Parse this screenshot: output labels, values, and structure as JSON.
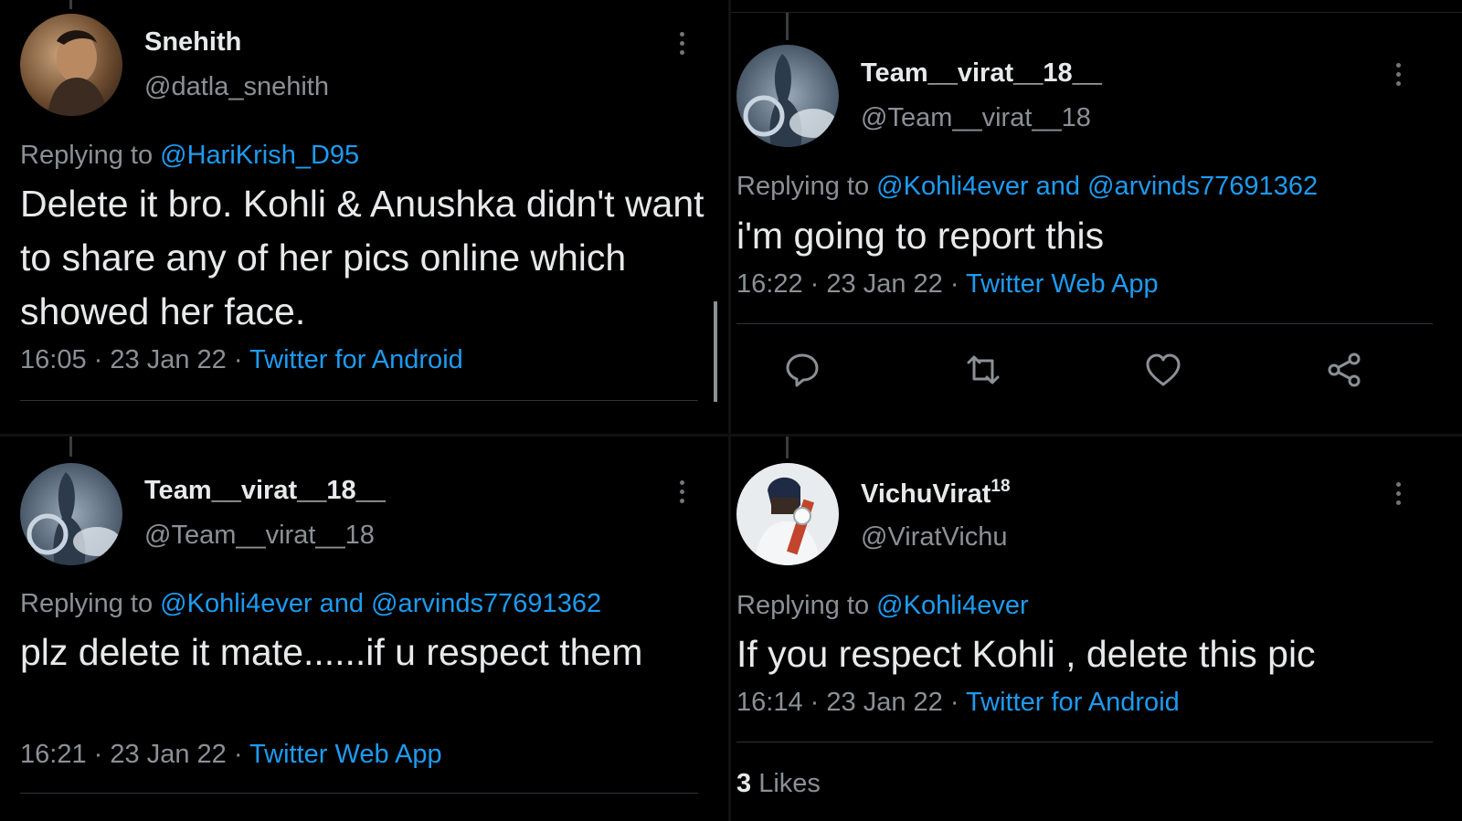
{
  "tweets": [
    {
      "name": "Snehith",
      "handle": "@datla_snehith",
      "replying_prefix": "Replying to",
      "replying_to": "@HariKrish_D95",
      "body": "Delete it bro. Kohli & Anushka didn't want to share any of her pics online which showed her face.",
      "time": "16:05",
      "date": "23 Jan 22",
      "source": "Twitter for Android"
    },
    {
      "name": "Team__virat__18__",
      "handle": "@Team__virat__18",
      "replying_prefix": "Replying to",
      "replying_to": "@Kohli4ever and @arvinds77691362",
      "body": "i'm going to report this",
      "time": "16:22",
      "date": "23 Jan 22",
      "source": "Twitter Web App"
    },
    {
      "name": "Team__virat__18__",
      "handle": "@Team__virat__18",
      "replying_prefix": "Replying to",
      "replying_to": "@Kohli4ever and @arvinds77691362",
      "body": "plz delete it mate......if u respect them",
      "time": "16:21",
      "date": "23 Jan 22",
      "source": "Twitter Web App"
    },
    {
      "name": "VichuVirat",
      "name_sup": "18",
      "handle": "@ViratVichu",
      "replying_prefix": "Replying to",
      "replying_to": "@Kohli4ever",
      "body": "If you respect Kohli , delete this pic",
      "time": "16:14",
      "date": "23 Jan 22",
      "source": "Twitter for Android",
      "likes_count": "3",
      "likes_label": "Likes"
    }
  ],
  "separator": "·",
  "actions": [
    "reply-icon",
    "retweet-icon",
    "like-icon",
    "share-icon"
  ],
  "colors": {
    "background": "#000000",
    "text": "#e7e9ea",
    "muted": "#8b9096",
    "link": "#1d9bf0",
    "divider": "#2f3336"
  }
}
